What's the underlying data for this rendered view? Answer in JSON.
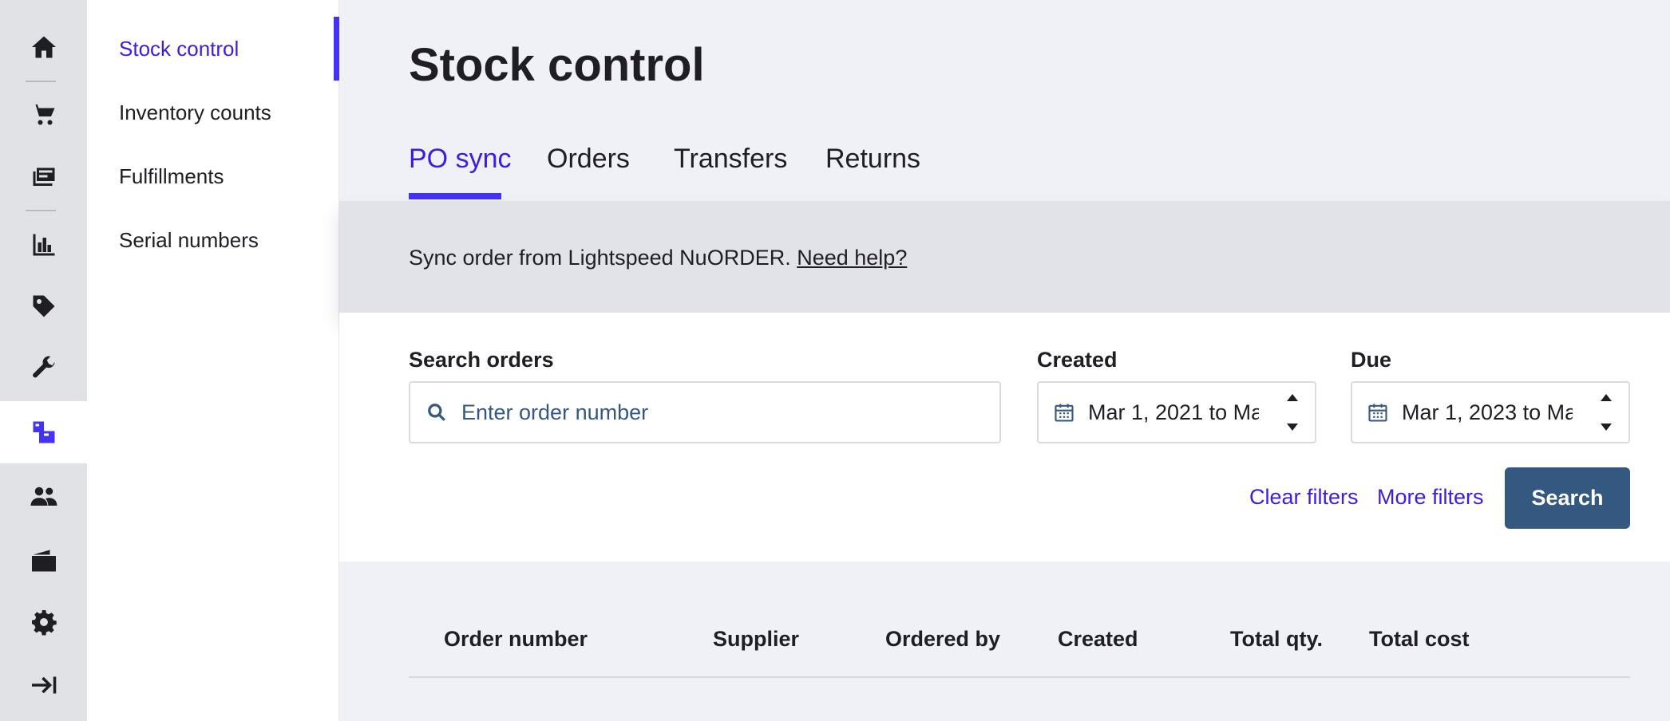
{
  "rail": {
    "items": [
      {
        "icon": "home-icon"
      },
      {
        "icon": "cart-icon"
      },
      {
        "icon": "register-icon"
      },
      {
        "icon": "reports-icon"
      },
      {
        "icon": "tag-icon"
      },
      {
        "icon": "wrench-icon"
      },
      {
        "icon": "inventory-boxes-icon",
        "active": true
      },
      {
        "icon": "customers-icon"
      },
      {
        "icon": "wallet-icon"
      },
      {
        "icon": "gear-icon"
      },
      {
        "icon": "collapse-arrow-icon"
      }
    ],
    "accent_color": "#4533f5"
  },
  "subnav": {
    "items": [
      {
        "label": "Stock control",
        "active": true
      },
      {
        "label": "Inventory counts"
      },
      {
        "label": "Fulfillments"
      },
      {
        "label": "Serial numbers"
      }
    ]
  },
  "page": {
    "title": "Stock control",
    "tabs": [
      {
        "label": "PO sync",
        "active": true
      },
      {
        "label": "Orders"
      },
      {
        "label": "Transfers"
      },
      {
        "label": "Returns"
      }
    ]
  },
  "banner": {
    "text": "Sync order from Lightspeed NuORDER.",
    "link": "Need help?"
  },
  "filters": {
    "search_label": "Search orders",
    "search_placeholder": "Enter order number",
    "created_label": "Created",
    "created_value": "Mar 1, 2021 to Ma",
    "due_label": "Due",
    "due_value": "Mar 1, 2023 to Ma",
    "clear_filters": "Clear filters",
    "more_filters": "More filters",
    "search_button": "Search",
    "button_color": "#34587f"
  },
  "table": {
    "columns": [
      "Order number",
      "Supplier",
      "Ordered by",
      "Created",
      "Total qty.",
      "Total cost"
    ]
  }
}
